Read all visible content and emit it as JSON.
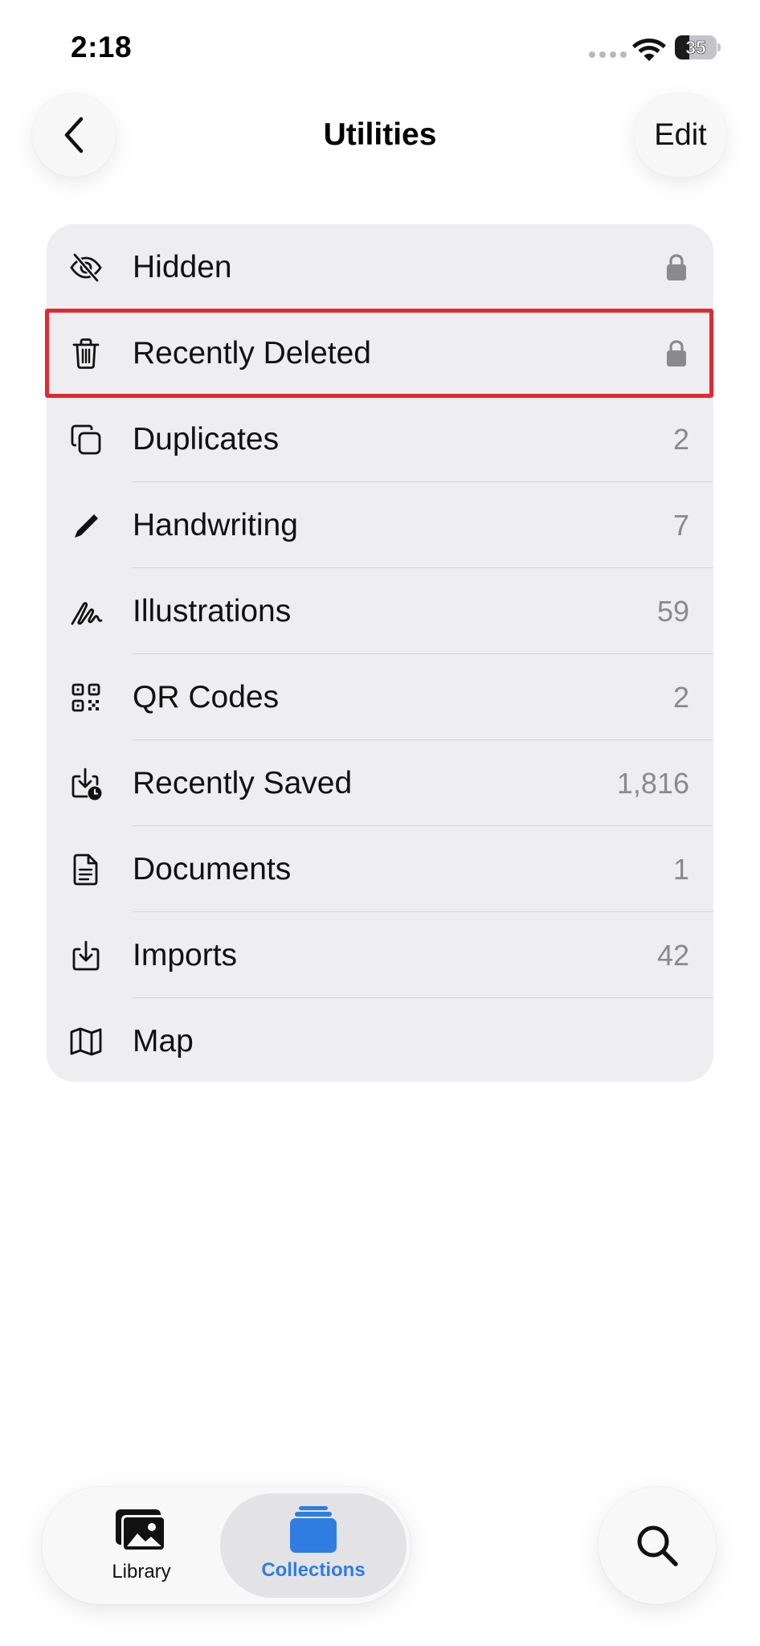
{
  "status_bar": {
    "time": "2:18",
    "battery_level": "35",
    "battery_fraction": 0.35
  },
  "nav": {
    "title": "Utilities",
    "edit_label": "Edit",
    "back_icon": "chevron-left-icon"
  },
  "utilities": {
    "items": [
      {
        "label": "Hidden",
        "icon": "eye-slash-icon",
        "trailing": "lock"
      },
      {
        "label": "Recently Deleted",
        "icon": "trash-icon",
        "trailing": "lock",
        "highlighted": true
      },
      {
        "label": "Duplicates",
        "icon": "duplicate-icon",
        "count": "2"
      },
      {
        "label": "Handwriting",
        "icon": "pencil-icon",
        "count": "7"
      },
      {
        "label": "Illustrations",
        "icon": "scribble-icon",
        "count": "59"
      },
      {
        "label": "QR Codes",
        "icon": "qr-code-icon",
        "count": "2"
      },
      {
        "label": "Recently Saved",
        "icon": "download-clock-icon",
        "count": "1,816"
      },
      {
        "label": "Documents",
        "icon": "document-icon",
        "count": "1"
      },
      {
        "label": "Imports",
        "icon": "import-icon",
        "count": "42"
      },
      {
        "label": "Map",
        "icon": "map-icon"
      }
    ]
  },
  "tab_bar": {
    "library_label": "Library",
    "collections_label": "Collections",
    "active_tab": "Collections",
    "active_color": "#2f7de1"
  },
  "colors": {
    "highlight_border": "#e02a31",
    "card_background": "#eeeef0",
    "count_text": "#8a8a8e"
  }
}
